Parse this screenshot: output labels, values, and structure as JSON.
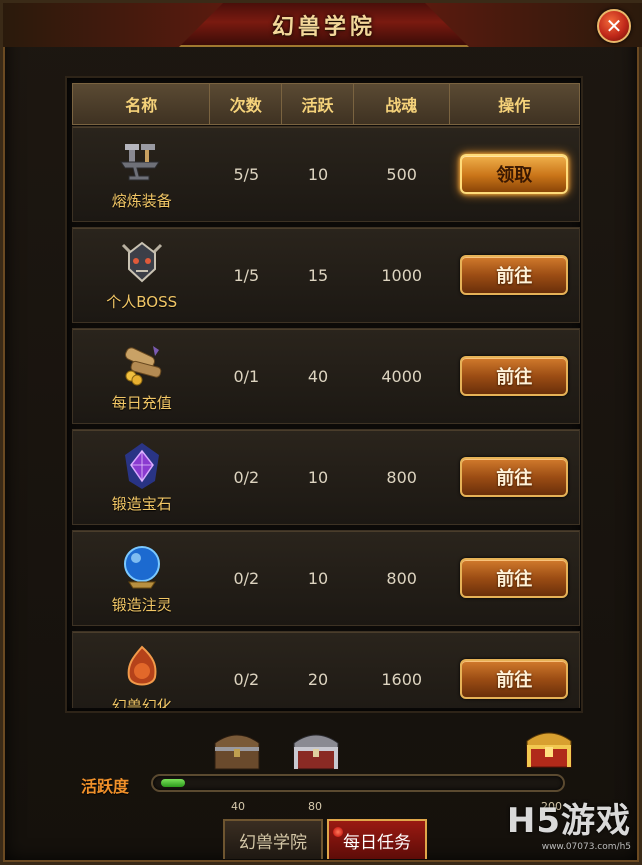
{
  "window": {
    "title": "幻兽学院"
  },
  "table": {
    "headers": [
      "名称",
      "次数",
      "活跃",
      "战魂",
      "操作"
    ],
    "rows": [
      {
        "name": "熔炼装备",
        "icon": "anvil-icon",
        "count": "5/5",
        "activity": "10",
        "soul": "500",
        "action": "领取",
        "state": "claim"
      },
      {
        "name": "个人BOSS",
        "icon": "boss-skull-icon",
        "count": "1/5",
        "activity": "15",
        "soul": "1000",
        "action": "前往",
        "state": "go"
      },
      {
        "name": "每日充值",
        "icon": "gold-scroll-icon",
        "count": "0/1",
        "activity": "40",
        "soul": "4000",
        "action": "前往",
        "state": "go"
      },
      {
        "name": "锻造宝石",
        "icon": "purple-gem-icon",
        "count": "0/2",
        "activity": "10",
        "soul": "800",
        "action": "前往",
        "state": "go"
      },
      {
        "name": "锻造注灵",
        "icon": "blue-orb-icon",
        "count": "0/2",
        "activity": "10",
        "soul": "800",
        "action": "前往",
        "state": "go"
      },
      {
        "name": "幻兽幻化",
        "icon": "fire-beast-icon",
        "count": "0/2",
        "activity": "20",
        "soul": "1600",
        "action": "前往",
        "state": "go"
      }
    ]
  },
  "activity": {
    "label": "活跃度",
    "progress_fraction": 0.06,
    "milestones": [
      {
        "value": "40",
        "chest": "wooden-chest-icon"
      },
      {
        "value": "80",
        "chest": "silver-chest-icon"
      },
      {
        "value": "200",
        "chest": "gold-chest-icon"
      }
    ]
  },
  "tabs": [
    {
      "label": "幻兽学院",
      "active": false
    },
    {
      "label": "每日任务",
      "active": true
    }
  ],
  "watermark": {
    "main": "H5游戏",
    "url": "www.07073.com/h5"
  },
  "colors": {
    "accent": "#f2c766",
    "button": "#c0651e",
    "title_bar": "#7a1a10",
    "progress": "#3fbf2a"
  }
}
